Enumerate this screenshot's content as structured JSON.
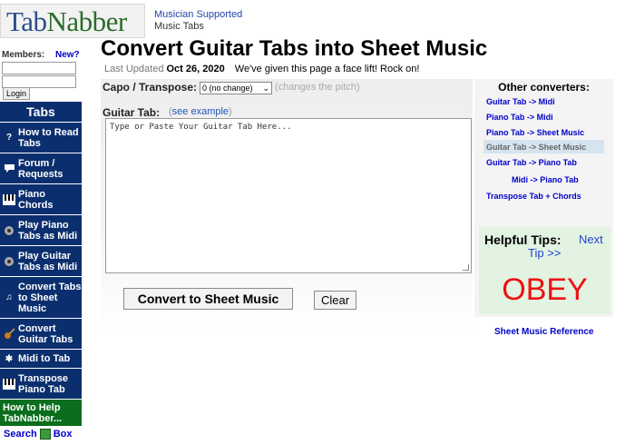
{
  "header": {
    "logo": "TabNabber",
    "logo_part1": "Tab",
    "logo_part2": "Nabber",
    "tagline_line1": "Musician Supported",
    "tagline_line2": "Music Tabs"
  },
  "page": {
    "title": "Convert Guitar Tabs into Sheet Music",
    "updated_label": "Last Updated",
    "updated_date": "Oct 26, 2020",
    "updated_note": "We've given this page a face lift! Rock on!"
  },
  "login": {
    "members_label": "Members:",
    "new_link": "New?",
    "username_value": "",
    "password_value": "",
    "login_button": "Login"
  },
  "nav": {
    "header": "Tabs",
    "items": [
      {
        "label": "How to Read Tabs",
        "icon": "question-icon"
      },
      {
        "label": "Forum / Requests",
        "icon": "speech-bubble-icon"
      },
      {
        "label": "Piano Chords",
        "icon": "piano-keys-icon"
      },
      {
        "label": "Play Piano Tabs as Midi",
        "icon": "speaker-icon"
      },
      {
        "label": "Play Guitar Tabs as Midi",
        "icon": "speaker-icon"
      },
      {
        "label": "Convert Tabs to Sheet Music",
        "icon": "music-note-icon"
      },
      {
        "label": "Convert Guitar Tabs",
        "icon": "guitar-icon"
      },
      {
        "label": "Midi to Tab",
        "icon": "gear-icon"
      },
      {
        "label": "Transpose Piano Tab",
        "icon": "piano-keys-icon"
      }
    ],
    "help": "How to Help TabNabber...",
    "search_part1": "Search",
    "search_part2": "Box"
  },
  "form": {
    "capo_label": "Capo / Transpose:",
    "capo_value": "0 (no change)",
    "capo_hint": "(changes the pitch)",
    "tab_label": "Guitar Tab:",
    "see_example_open": "(",
    "see_example": "see example",
    "see_example_close": ")",
    "tab_placeholder": "Type or Paste Your Guitar Tab Here...",
    "convert_button": "Convert to Sheet Music",
    "clear_button": "Clear"
  },
  "sidebar_right": {
    "title": "Other converters:",
    "links": [
      {
        "label": "Guitar Tab -> Midi"
      },
      {
        "label": "Piano Tab -> Midi"
      },
      {
        "label": "Piano Tab -> Sheet Music"
      },
      {
        "label": "Guitar Tab -> Sheet Music",
        "selected": true
      },
      {
        "label": "Guitar Tab -> Piano Tab"
      },
      {
        "label": "Midi -> Piano Tab"
      },
      {
        "label": "Transpose Tab + Chords"
      }
    ],
    "tips_title": "Helpful Tips:",
    "tips_next": "Next",
    "tips_next2": "Tip >>",
    "tip_text": "OBEY",
    "sheet_ref": "Sheet Music Reference"
  },
  "colors": {
    "nav_blue": "#0b2f6e",
    "help_green": "#0a6e1c",
    "obey_red": "#ee1111",
    "link_blue": "#0000cc"
  }
}
